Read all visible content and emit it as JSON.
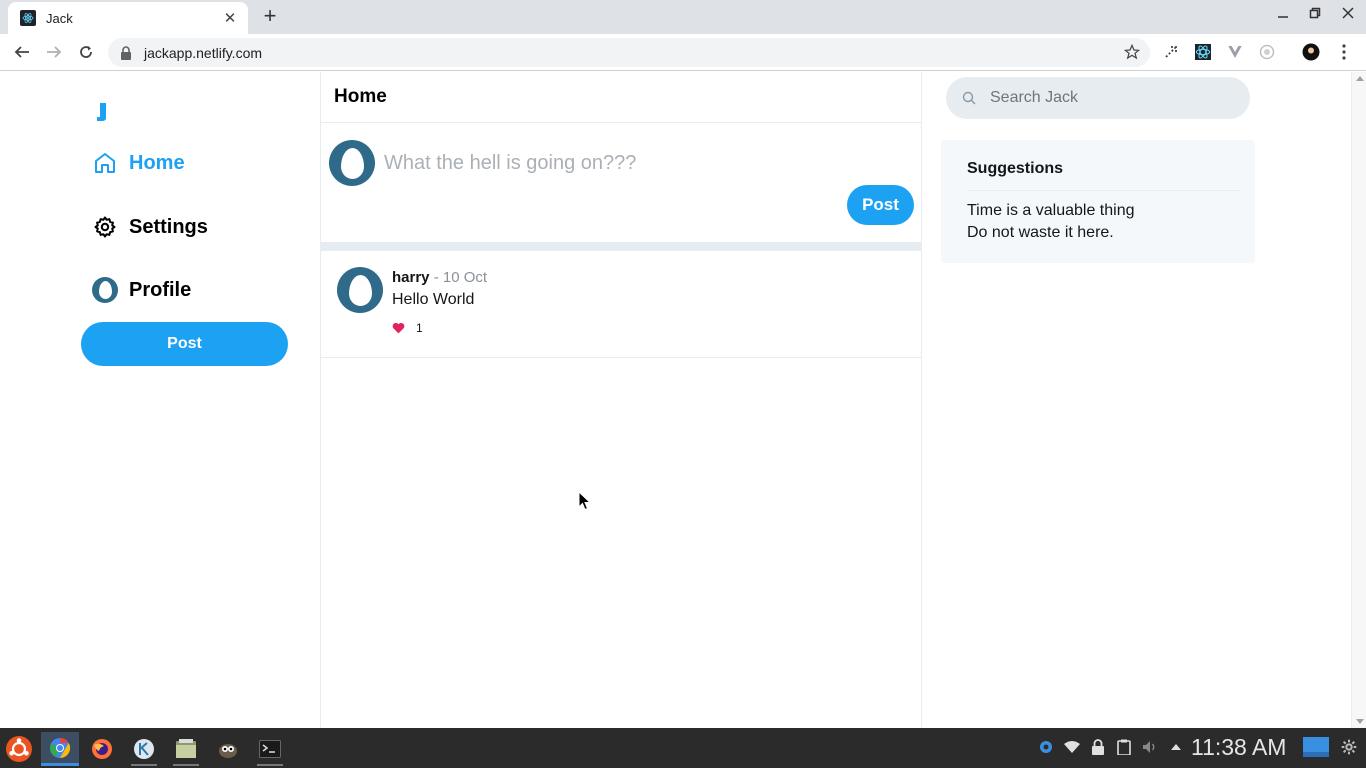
{
  "browser": {
    "tab_title": "Jack",
    "url": "jackapp.netlify.com"
  },
  "nav": {
    "home": "Home",
    "settings": "Settings",
    "profile": "Profile",
    "post_button": "Post"
  },
  "main": {
    "title": "Home",
    "composer_placeholder": "What the hell is going on???",
    "post_button": "Post"
  },
  "feed": [
    {
      "user": "harry",
      "date": "- 10 Oct",
      "text": "Hello World",
      "likes": "1"
    }
  ],
  "search": {
    "placeholder": "Search Jack"
  },
  "suggestions": {
    "title": "Suggestions",
    "lines": [
      "Time is a valuable thing",
      "Do not waste it here."
    ]
  },
  "taskbar": {
    "clock": "11:38 AM"
  },
  "colors": {
    "accent": "#1da1f2",
    "avatar_bg": "#2f6a8a",
    "heart": "#e0245e",
    "border": "#e6ecf0"
  }
}
